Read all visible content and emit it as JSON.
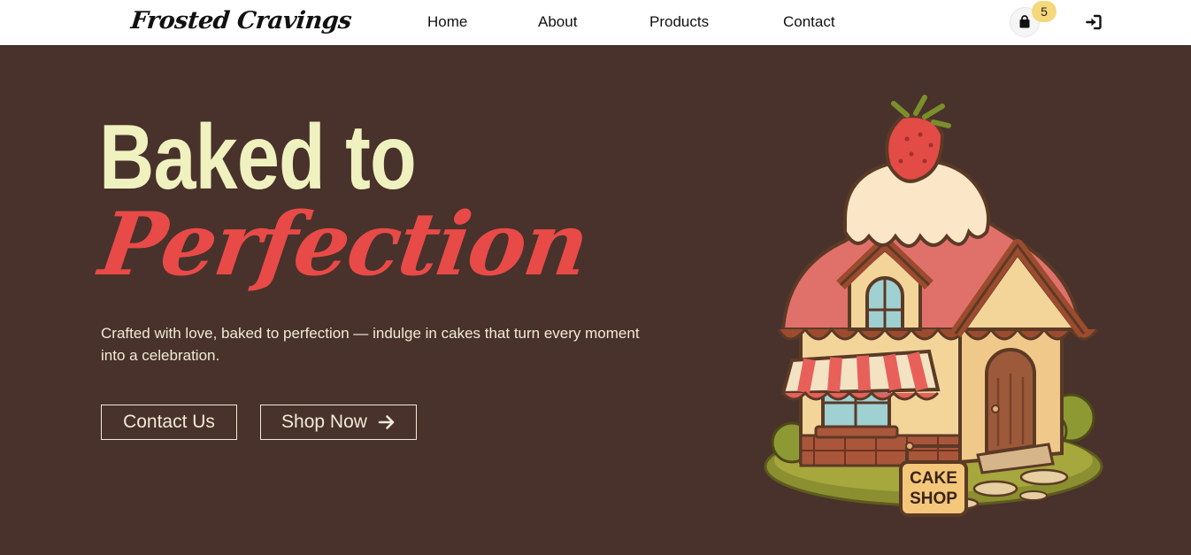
{
  "brand": {
    "logo_text": "Frosted Cravings"
  },
  "nav": {
    "links": [
      {
        "label": "Home"
      },
      {
        "label": "About"
      },
      {
        "label": "Products"
      },
      {
        "label": "Contact"
      }
    ],
    "cart": {
      "icon": "shopping-bag-icon",
      "count": "5"
    },
    "login": {
      "icon": "sign-in-icon"
    }
  },
  "hero": {
    "title_line1": "Baked to",
    "title_line2": "Perfection",
    "description": "Crafted with love, baked to perfection — indulge in cakes that turn every moment into a celebration.",
    "buttons": {
      "contact_label": "Contact Us",
      "shop_label": "Shop Now",
      "shop_icon": "arrow-right-icon"
    },
    "illustration": {
      "sign_line1": "CAKE",
      "sign_line2": "SHOP"
    }
  },
  "colors": {
    "hero_bg": "#48322b",
    "title_cream": "#eff1bf",
    "title_red": "#e84a48",
    "badge_yellow": "#f6d77a"
  }
}
